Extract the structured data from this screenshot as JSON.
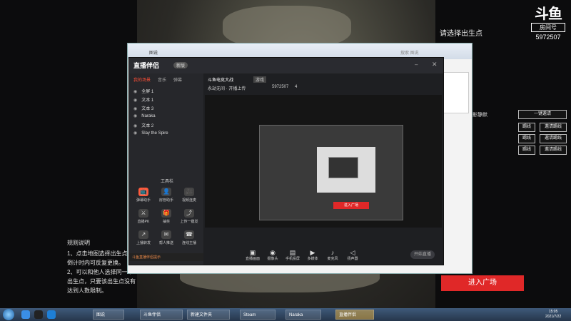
{
  "overlay": {
    "choose_title": "请选择出生点",
    "logo_text": "斗鱼",
    "room_label": "房间号",
    "room_number": "5972507",
    "invite_once": "一键邀请",
    "rows": [
      {
        "left": "踢线",
        "right": "邀请踢线"
      },
      {
        "left": "踢线",
        "right": "邀请踢线"
      },
      {
        "left": "踢线",
        "right": "邀请踢线"
      }
    ],
    "side_label": "影静默",
    "enter_button": "进入广场",
    "rules_title": "规则说明",
    "rules": [
      "1、点击地图选择出生点，",
      "倒计时内可反复更换。",
      "2、可以和他人选择同一个",
      "出生点，只要该出生点没有",
      "达到人数限制。"
    ]
  },
  "explorer": {
    "address": "图说",
    "search_placeholder": "搜索 图说"
  },
  "companion": {
    "app_name": "直播伴侣",
    "badge": "新版",
    "tabs": [
      "我的场景",
      "音乐",
      "弹幕"
    ],
    "scenes": [
      "全屏 1",
      "文本 1",
      "文本 3",
      "Naraka",
      "文本 2",
      "Slay the Spire"
    ],
    "stream_title": "斗鱼电竞大战",
    "category_tag": "游戏",
    "status_line": "永劫无间 · 开播上传",
    "room_id": "5972507",
    "fans": "4",
    "tools_title": "工具栏",
    "tools": [
      {
        "label": "弹幕助手",
        "icon": "📺"
      },
      {
        "label": "房管助手",
        "icon": "👤"
      },
      {
        "label": "视频连麦",
        "icon": "🎥"
      },
      {
        "label": "直播PK",
        "icon": "⚔"
      },
      {
        "label": "抽奖",
        "icon": "🎁"
      },
      {
        "label": "上传一键发",
        "icon": "⤴"
      },
      {
        "label": "上播转发",
        "icon": "↗"
      },
      {
        "label": "帮人推送",
        "icon": "✉"
      },
      {
        "label": "连线主播",
        "icon": "☎"
      }
    ],
    "notice": "斗鱼直播伴侣提示",
    "controls": [
      {
        "label": "直播画面",
        "icon": "▣"
      },
      {
        "label": "摄像头",
        "icon": "◉"
      },
      {
        "label": "手机投屏",
        "icon": "▤"
      },
      {
        "label": "多媒体",
        "icon": "▶"
      },
      {
        "label": "麦克风",
        "icon": "♪"
      },
      {
        "label": "扬声器",
        "icon": "◁"
      }
    ],
    "start_button": "开始直播",
    "preview_red_button": "进入广场"
  },
  "taskbar": {
    "items": [
      {
        "label": "图说"
      },
      {
        "label": "斗鱼伴侣"
      },
      {
        "label": "新建文件夹"
      },
      {
        "label": "Steam"
      },
      {
        "label": "Naraka"
      },
      {
        "label": "直播伴侣"
      }
    ],
    "time": "15:05",
    "date": "2021/7/22"
  }
}
